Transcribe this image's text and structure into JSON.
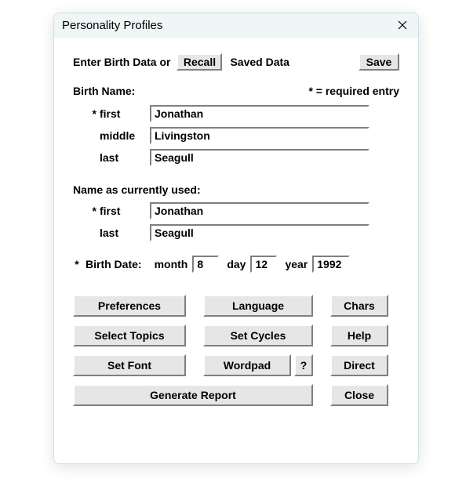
{
  "window": {
    "title": "Personality Profiles"
  },
  "header": {
    "enter_label": "Enter Birth Data or",
    "recall_label": "Recall",
    "saved_label": "Saved Data",
    "save_label": "Save"
  },
  "birth_name_section": {
    "label": "Birth Name:",
    "required_note": "* = required entry",
    "rows": {
      "first": {
        "star": "*",
        "label": "first",
        "value": "Jonathan"
      },
      "middle": {
        "star": "",
        "label": "middle",
        "value": "Livingston"
      },
      "last": {
        "star": "",
        "label": "last",
        "value": "Seagull"
      }
    }
  },
  "current_name_section": {
    "label": "Name as currently used:",
    "rows": {
      "first": {
        "star": "*",
        "label": "first",
        "value": "Jonathan"
      },
      "last": {
        "star": "",
        "label": "last",
        "value": "Seagull"
      }
    }
  },
  "birth_date": {
    "star": "*",
    "label": "Birth Date:",
    "month_label": "month",
    "month_value": "8",
    "day_label": "day",
    "day_value": "12",
    "year_label": "year",
    "year_value": "1992"
  },
  "buttons": {
    "preferences": "Preferences",
    "language": "Language",
    "chars": "Chars",
    "select_topics": "Select Topics",
    "set_cycles": "Set Cycles",
    "help": "Help",
    "set_font": "Set Font",
    "wordpad": "Wordpad",
    "question": "?",
    "direct": "Direct",
    "generate_report": "Generate Report",
    "close": "Close"
  }
}
